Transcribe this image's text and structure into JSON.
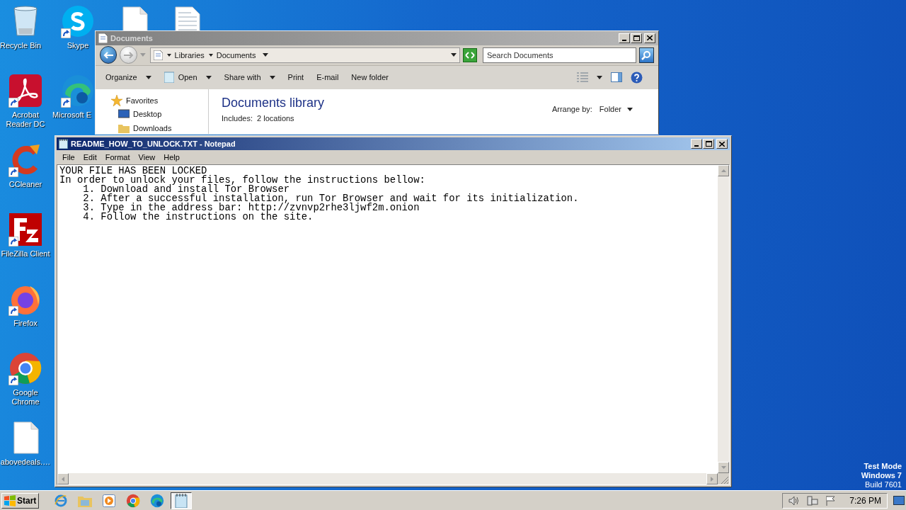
{
  "desktop": {
    "icons_column_1": [
      {
        "label": "Recycle Bin",
        "kind": "recycle",
        "shortcut": false
      },
      {
        "label": "Acrobat Reader DC",
        "kind": "acrobat",
        "shortcut": true
      },
      {
        "label": "CCleaner",
        "kind": "ccleaner",
        "shortcut": true
      },
      {
        "label": "FileZilla Client",
        "kind": "filezilla",
        "shortcut": true
      },
      {
        "label": "Firefox",
        "kind": "firefox",
        "shortcut": true
      },
      {
        "label": "Google Chrome",
        "kind": "chrome",
        "shortcut": true
      },
      {
        "label": "abovedeals.…",
        "kind": "file",
        "shortcut": false
      }
    ],
    "icons_column_2": [
      {
        "label": "Skype",
        "kind": "skype",
        "shortcut": true
      },
      {
        "label": "Microsoft E",
        "kind": "edge",
        "shortcut": true
      }
    ],
    "icons_top": [
      {
        "kind": "file"
      },
      {
        "kind": "textfile"
      }
    ],
    "system_text": [
      "Test Mode",
      "Windows 7",
      "Build 7601"
    ]
  },
  "explorer": {
    "title": "Documents",
    "breadcrumb": [
      "Libraries",
      "Documents"
    ],
    "search": {
      "placeholder": "Search Documents"
    },
    "toolbar": [
      {
        "label": "Organize",
        "dropdown": true,
        "kind": "plain"
      },
      {
        "label": "Open",
        "dropdown": true,
        "kind": "open"
      },
      {
        "label": "Share with",
        "dropdown": true,
        "kind": "plain"
      },
      {
        "label": "Print",
        "dropdown": false,
        "kind": "plain"
      },
      {
        "label": "E-mail",
        "dropdown": false,
        "kind": "plain"
      },
      {
        "label": "New folder",
        "dropdown": false,
        "kind": "plain"
      }
    ],
    "nav": [
      {
        "label": "Favorites",
        "kind": "star"
      },
      {
        "label": "Desktop",
        "kind": "desktop"
      },
      {
        "label": "Downloads",
        "kind": "folder"
      }
    ],
    "library": {
      "title": "Documents library",
      "includes_label": "Includes:",
      "includes_value": "2 locations",
      "arrange_label": "Arrange by:",
      "arrange_value": "Folder"
    }
  },
  "notepad": {
    "title": "README_HOW_TO_UNLOCK.TXT - Notepad",
    "menu": [
      "File",
      "Edit",
      "Format",
      "View",
      "Help"
    ],
    "lines": [
      "YOUR FILE HAS BEEN LOCKED",
      "In order to unlock your files, follow the instructions bellow:",
      "    1. Download and install Tor Browser",
      "    2. After a successful installation, run Tor Browser and wait for its initialization.",
      "    3. Type in the address bar: http://zvnvp2rhe3ljwf2m.onion",
      "    4. Follow the instructions on the site."
    ]
  },
  "taskbar": {
    "start": "Start",
    "items": [
      {
        "kind": "ie",
        "selected": false
      },
      {
        "kind": "explorer",
        "selected": false
      },
      {
        "kind": "media",
        "selected": false
      },
      {
        "kind": "chrome",
        "selected": false
      },
      {
        "kind": "edge",
        "selected": false
      },
      {
        "kind": "notepad",
        "selected": true
      }
    ],
    "time": "7:26 PM"
  }
}
